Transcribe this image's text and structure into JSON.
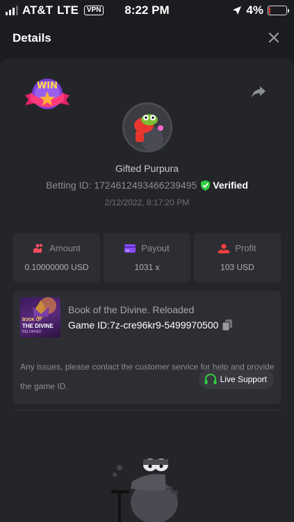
{
  "status": {
    "carrier": "AT&T",
    "network": "LTE",
    "vpn": "VPN",
    "time": "8:22 PM",
    "battery": "4%",
    "battery_level": 0.04,
    "battery_color": "#e53935"
  },
  "header": {
    "title": "Details"
  },
  "bet": {
    "badge_text": "WIN",
    "username": "Gifted Purpura",
    "betting_id_label": "Betting ID: 1724612493466239495",
    "verified": "Verified",
    "date": "2/12/2022, 8:17:20 PM"
  },
  "stats": [
    {
      "label": "Amount",
      "value": "0.10000000 USD",
      "icon": "amount-icon",
      "color": "#ff4d5e"
    },
    {
      "label": "Payout",
      "value": "1031 x",
      "icon": "payout-card-icon",
      "color": "#8a4dff"
    },
    {
      "label": "Profit",
      "value": "103 USD",
      "icon": "profit-icon",
      "color": "#ff4040"
    }
  ],
  "game": {
    "name": "Book of the Divine. Reloaded",
    "id_label": "Game ID:7z-cre96kr9-5499970500",
    "thumb_line1": "BOOK OF",
    "thumb_line2": "THE DIVINE",
    "thumb_line3": "RELOADED",
    "notice": "Any issues, please contact the customer service for help and provide the game ID.",
    "support_label": "Live Support",
    "support_icon_color": "#2ecc40"
  },
  "colors": {
    "background": "#1b1c1f",
    "card": "#242529",
    "tile": "#2d2e33",
    "verified_green": "#2ecc40"
  }
}
